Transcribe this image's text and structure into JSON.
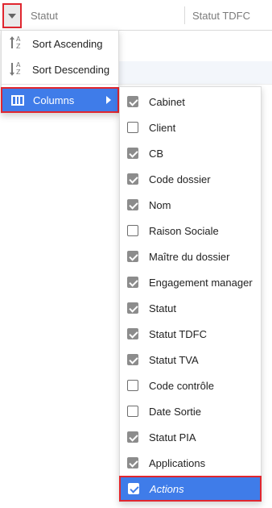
{
  "header": {
    "columns": [
      "Statut",
      "Statut TDFC"
    ]
  },
  "menu": {
    "sort_ascending": "Sort Ascending",
    "sort_descending": "Sort Descending",
    "columns": "Columns"
  },
  "columns_submenu": [
    {
      "label": "Cabinet",
      "checked": true
    },
    {
      "label": "Client",
      "checked": false
    },
    {
      "label": "CB",
      "checked": true
    },
    {
      "label": "Code dossier",
      "checked": true
    },
    {
      "label": "Nom",
      "checked": true
    },
    {
      "label": "Raison Sociale",
      "checked": false
    },
    {
      "label": "Maître du dossier",
      "checked": true
    },
    {
      "label": "Engagement manager",
      "checked": true
    },
    {
      "label": "Statut",
      "checked": true
    },
    {
      "label": "Statut TDFC",
      "checked": true
    },
    {
      "label": "Statut TVA",
      "checked": true
    },
    {
      "label": "Code contrôle",
      "checked": false
    },
    {
      "label": "Date Sortie",
      "checked": false
    },
    {
      "label": "Statut PIA",
      "checked": true
    },
    {
      "label": "Applications",
      "checked": true
    },
    {
      "label": "Actions",
      "checked": true,
      "active": true
    }
  ],
  "colors": {
    "accent": "#3f7ce9",
    "highlight_border": "#e0262f"
  }
}
